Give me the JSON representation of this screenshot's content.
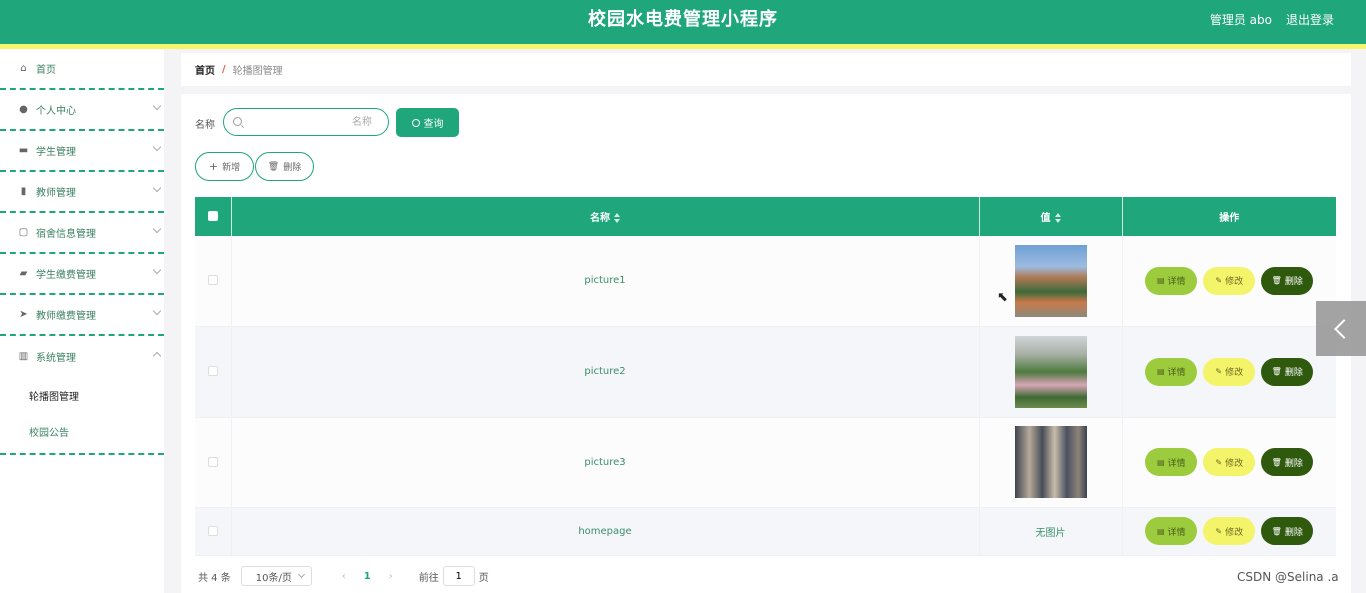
{
  "header": {
    "title": "校园水电费管理小程序",
    "admin": "管理员 abo",
    "logout": "退出登录"
  },
  "sidebar": {
    "items": [
      {
        "label": "首页",
        "icon": "home-icon"
      },
      {
        "label": "个人中心",
        "icon": "user-icon"
      },
      {
        "label": "学生管理",
        "icon": "monitor-icon"
      },
      {
        "label": "教师管理",
        "icon": "clipboard-icon"
      },
      {
        "label": "宿舍信息管理",
        "icon": "chat-icon"
      },
      {
        "label": "学生缴费管理",
        "icon": "briefcase-icon"
      },
      {
        "label": "教师缴费管理",
        "icon": "send-icon"
      },
      {
        "label": "系统管理",
        "icon": "chart-icon"
      }
    ],
    "submenu": [
      {
        "label": "轮播图管理"
      },
      {
        "label": "校园公告"
      }
    ]
  },
  "breadcrumb": {
    "home": "首页",
    "sep": "/",
    "current": "轮播图管理"
  },
  "search": {
    "label": "名称",
    "placeholder": "名称",
    "query_label": "查询"
  },
  "actions": {
    "add_label": "新增",
    "delete_label": "删除"
  },
  "table": {
    "headers": {
      "name": "名称",
      "value": "值",
      "ops": "操作"
    },
    "rows": [
      {
        "name": "picture1",
        "value": ""
      },
      {
        "name": "picture2",
        "value": ""
      },
      {
        "name": "picture3",
        "value": ""
      },
      {
        "name": "homepage",
        "value": "无图片"
      }
    ],
    "op_labels": {
      "detail": "详情",
      "edit": "修改",
      "remove": "删除"
    }
  },
  "pagination": {
    "total": "共 4 条",
    "page_size": "10条/页",
    "current_page": "1",
    "goto_label": "前往",
    "goto_value": "1",
    "page_suffix": "页"
  },
  "watermark": "CSDN @Selina .a",
  "colors": {
    "primary": "#1fa67b",
    "accent_yellow": "#f6f56a",
    "detail_btn": "#9ccc3d",
    "edit_btn": "#f4f46a",
    "delete_btn": "#2f5a0e"
  }
}
